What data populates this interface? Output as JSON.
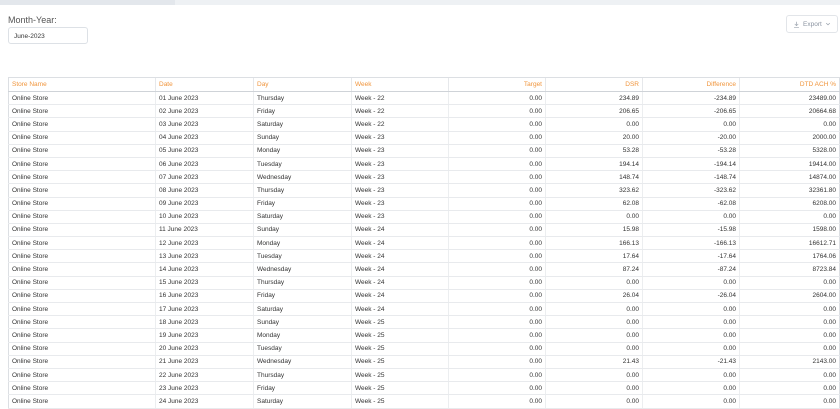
{
  "filter": {
    "label": "Month-Year:",
    "value": "June-2023"
  },
  "toolbar": {
    "export_label": "Export"
  },
  "table": {
    "columns": [
      "Store Name",
      "Date",
      "Day",
      "Week",
      "Target",
      "DSR",
      "Difference",
      "DTD ACH %"
    ],
    "rows": [
      [
        "Online Store",
        "01 June 2023",
        "Thursday",
        "Week - 22",
        "0.00",
        "234.89",
        "-234.89",
        "23489.00"
      ],
      [
        "Online Store",
        "02 June 2023",
        "Friday",
        "Week - 22",
        "0.00",
        "206.65",
        "-206.65",
        "20664.68"
      ],
      [
        "Online Store",
        "03 June 2023",
        "Saturday",
        "Week - 22",
        "0.00",
        "0.00",
        "0.00",
        "0.00"
      ],
      [
        "Online Store",
        "04 June 2023",
        "Sunday",
        "Week - 23",
        "0.00",
        "20.00",
        "-20.00",
        "2000.00"
      ],
      [
        "Online Store",
        "05 June 2023",
        "Monday",
        "Week - 23",
        "0.00",
        "53.28",
        "-53.28",
        "5328.00"
      ],
      [
        "Online Store",
        "06 June 2023",
        "Tuesday",
        "Week - 23",
        "0.00",
        "194.14",
        "-194.14",
        "19414.00"
      ],
      [
        "Online Store",
        "07 June 2023",
        "Wednesday",
        "Week - 23",
        "0.00",
        "148.74",
        "-148.74",
        "14874.00"
      ],
      [
        "Online Store",
        "08 June 2023",
        "Thursday",
        "Week - 23",
        "0.00",
        "323.62",
        "-323.62",
        "32361.80"
      ],
      [
        "Online Store",
        "09 June 2023",
        "Friday",
        "Week - 23",
        "0.00",
        "62.08",
        "-62.08",
        "6208.00"
      ],
      [
        "Online Store",
        "10 June 2023",
        "Saturday",
        "Week - 23",
        "0.00",
        "0.00",
        "0.00",
        "0.00"
      ],
      [
        "Online Store",
        "11 June 2023",
        "Sunday",
        "Week - 24",
        "0.00",
        "15.98",
        "-15.98",
        "1598.00"
      ],
      [
        "Online Store",
        "12 June 2023",
        "Monday",
        "Week - 24",
        "0.00",
        "166.13",
        "-166.13",
        "16612.71"
      ],
      [
        "Online Store",
        "13 June 2023",
        "Tuesday",
        "Week - 24",
        "0.00",
        "17.64",
        "-17.64",
        "1764.06"
      ],
      [
        "Online Store",
        "14 June 2023",
        "Wednesday",
        "Week - 24",
        "0.00",
        "87.24",
        "-87.24",
        "8723.84"
      ],
      [
        "Online Store",
        "15 June 2023",
        "Thursday",
        "Week - 24",
        "0.00",
        "0.00",
        "0.00",
        "0.00"
      ],
      [
        "Online Store",
        "16 June 2023",
        "Friday",
        "Week - 24",
        "0.00",
        "26.04",
        "-26.04",
        "2604.00"
      ],
      [
        "Online Store",
        "17 June 2023",
        "Saturday",
        "Week - 24",
        "0.00",
        "0.00",
        "0.00",
        "0.00"
      ],
      [
        "Online Store",
        "18 June 2023",
        "Sunday",
        "Week - 25",
        "0.00",
        "0.00",
        "0.00",
        "0.00"
      ],
      [
        "Online Store",
        "19 June 2023",
        "Monday",
        "Week - 25",
        "0.00",
        "0.00",
        "0.00",
        "0.00"
      ],
      [
        "Online Store",
        "20 June 2023",
        "Tuesday",
        "Week - 25",
        "0.00",
        "0.00",
        "0.00",
        "0.00"
      ],
      [
        "Online Store",
        "21 June 2023",
        "Wednesday",
        "Week - 25",
        "0.00",
        "21.43",
        "-21.43",
        "2143.00"
      ],
      [
        "Online Store",
        "22 June 2023",
        "Thursday",
        "Week - 25",
        "0.00",
        "0.00",
        "0.00",
        "0.00"
      ],
      [
        "Online Store",
        "23 June 2023",
        "Friday",
        "Week - 25",
        "0.00",
        "0.00",
        "0.00",
        "0.00"
      ],
      [
        "Online Store",
        "24 June 2023",
        "Saturday",
        "Week - 25",
        "0.00",
        "0.00",
        "0.00",
        "0.00"
      ]
    ]
  },
  "colors": {
    "header_text": "#f0953c",
    "border": "#dcdfe3"
  }
}
